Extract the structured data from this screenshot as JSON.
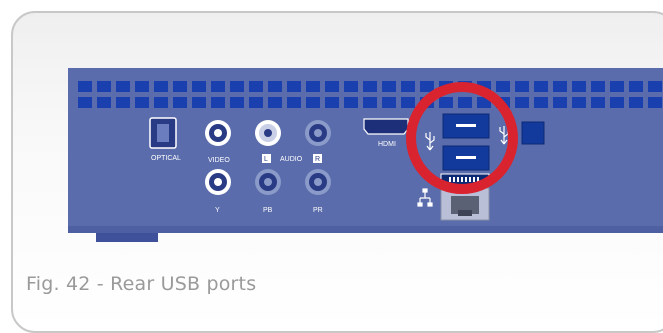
{
  "figure": {
    "caption": "Fig. 42 - Rear USB ports"
  },
  "panel": {
    "labels": {
      "optical": "OPTICAL",
      "video": "VIDEO",
      "audio": "AUDIO",
      "left": "L",
      "right": "R",
      "y": "Y",
      "pb": "PB",
      "pr": "PR",
      "hdmi": "HDMI"
    }
  },
  "colors": {
    "panel_blue": "#5a6cab",
    "panel_shadow": "#4a5a96",
    "vent_blue": "#1a3fae",
    "highlight_red": "#d9232e",
    "port_dark_blue": "#123a9c",
    "rca_gray": "#8a9ac9"
  },
  "icons": [
    "usb-icon",
    "ethernet-icon"
  ]
}
